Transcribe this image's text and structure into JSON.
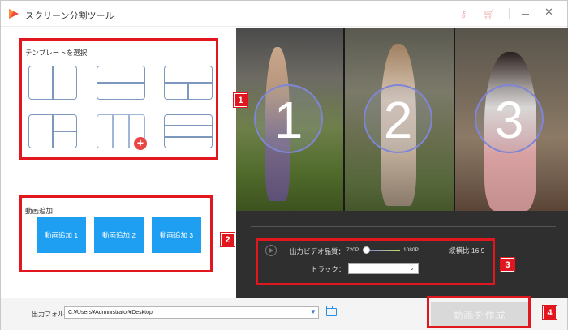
{
  "window": {
    "title": "スクリーン分割ツール",
    "icons": [
      "app-logo-icon",
      "key-icon",
      "cart-icon",
      "minimize-icon",
      "close-icon"
    ]
  },
  "templates": {
    "title": "テンプレートを選択",
    "items": [
      {
        "name": "two-columns"
      },
      {
        "name": "two-rows"
      },
      {
        "name": "top-row-bottom-split"
      },
      {
        "name": "left-col-right-split"
      },
      {
        "name": "three-columns",
        "selected": true
      },
      {
        "name": "three-rows"
      }
    ]
  },
  "video_add": {
    "title": "動画追加",
    "buttons": [
      "動画追加 1",
      "動画追加 2",
      "動画追加 3"
    ],
    "color": "#1e9ff2"
  },
  "preview": {
    "panes": [
      "1",
      "2",
      "3"
    ]
  },
  "output": {
    "quality_label": "出力ビデオ品質：",
    "quality_min": "720P",
    "quality_max": "1080P",
    "quality_level": 0,
    "ratio_label": "縦横比 16:9",
    "track_label": "トラック：",
    "track_value": ""
  },
  "footer": {
    "folder_label": "出力フォルダ：",
    "folder_path": "C:¥Users¥Administrator¥Desktop",
    "create_button": "動画を作成"
  },
  "annotations": {
    "badges": [
      "1",
      "2",
      "3",
      "4"
    ],
    "color": "#e2161e"
  }
}
